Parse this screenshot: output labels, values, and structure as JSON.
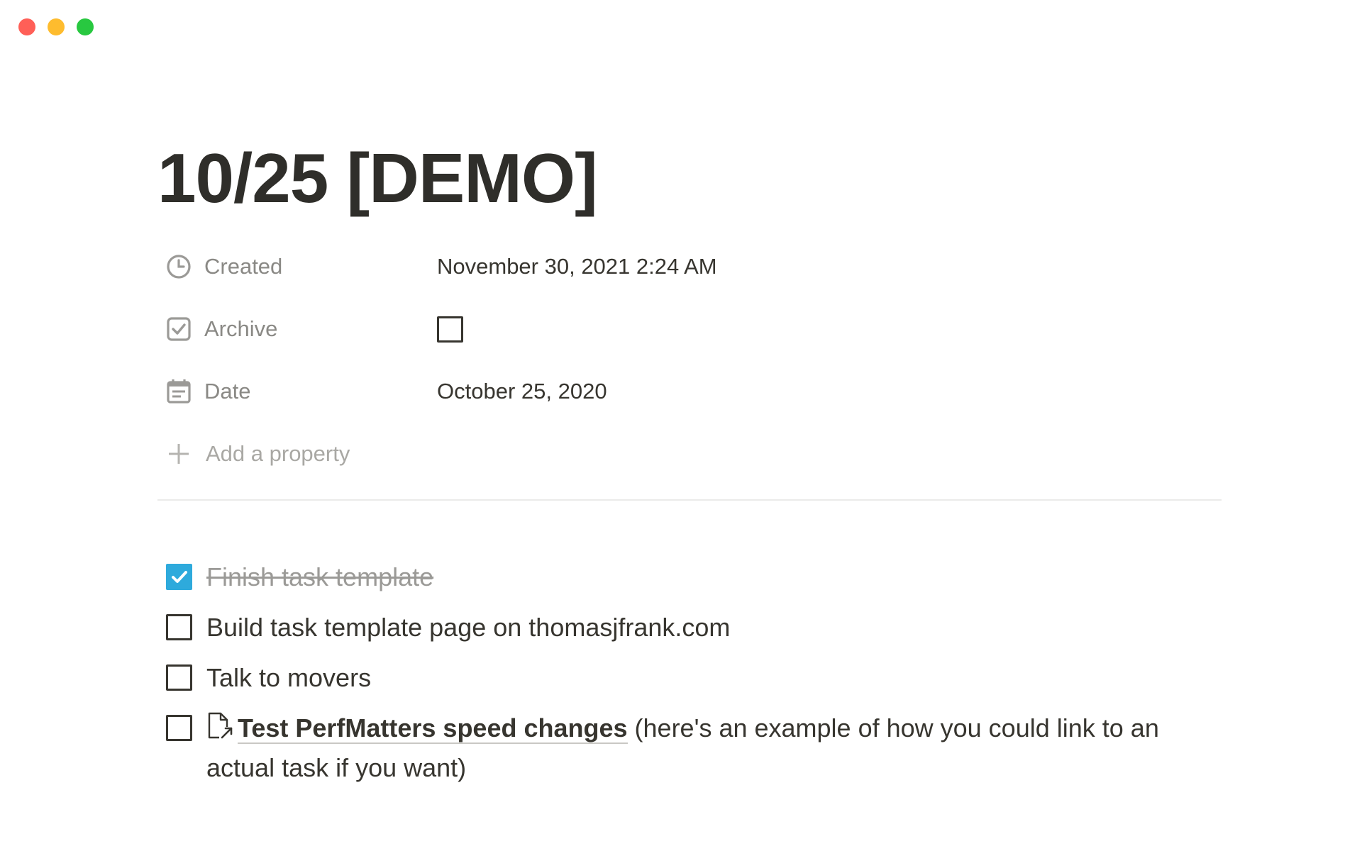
{
  "window": {
    "controls": [
      "close",
      "minimize",
      "zoom"
    ],
    "colors": {
      "close": "#ff5f57",
      "minimize": "#febc2e",
      "zoom": "#28c840"
    }
  },
  "page": {
    "title": "10/25 [DEMO]"
  },
  "properties": [
    {
      "icon": "clock-icon",
      "label": "Created",
      "value": "November 30, 2021 2:24 AM",
      "type": "created_time"
    },
    {
      "icon": "checkbox-icon",
      "label": "Archive",
      "value": "",
      "type": "checkbox",
      "checked": false
    },
    {
      "icon": "calendar-icon",
      "label": "Date",
      "value": "October 25, 2020",
      "type": "date"
    }
  ],
  "add_property": {
    "icon": "plus-icon",
    "label": "Add a property"
  },
  "todos": [
    {
      "checked": true,
      "text": "Finish task template"
    },
    {
      "checked": false,
      "text": "Build task template page on thomasjfrank.com"
    },
    {
      "checked": false,
      "text": "Talk to movers"
    },
    {
      "checked": false,
      "link_icon": "page-link-icon",
      "link_text": "Test PerfMatters speed changes",
      "text": " (here's an example of how you could link to an actual task if you want)"
    }
  ],
  "colors": {
    "text": "#37352f",
    "muted": "#8a8985",
    "checked_box": "#2eaadc",
    "divider": "#ebebea"
  }
}
